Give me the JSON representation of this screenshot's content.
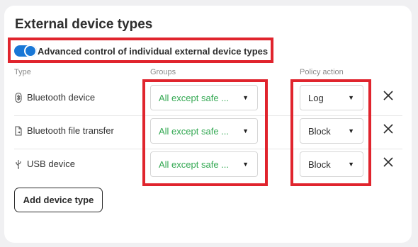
{
  "section": {
    "title": "External device types",
    "toggle": {
      "label": "Advanced control of individual external device types",
      "on": true
    }
  },
  "columns": {
    "type": "Type",
    "groups": "Groups",
    "policy": "Policy action"
  },
  "rows": [
    {
      "icon": "bluetooth-icon",
      "type": "Bluetooth device",
      "groups": "All except safe ...",
      "policy": "Log"
    },
    {
      "icon": "file-transfer-icon",
      "type": "Bluetooth file transfer",
      "groups": "All except safe ...",
      "policy": "Block"
    },
    {
      "icon": "usb-icon",
      "type": "USB device",
      "groups": "All except safe ...",
      "policy": "Block"
    }
  ],
  "add_button": {
    "label": "Add device type"
  },
  "colors": {
    "accent": "#1877d6",
    "group_text": "#33a852",
    "highlight": "#e0242d"
  }
}
